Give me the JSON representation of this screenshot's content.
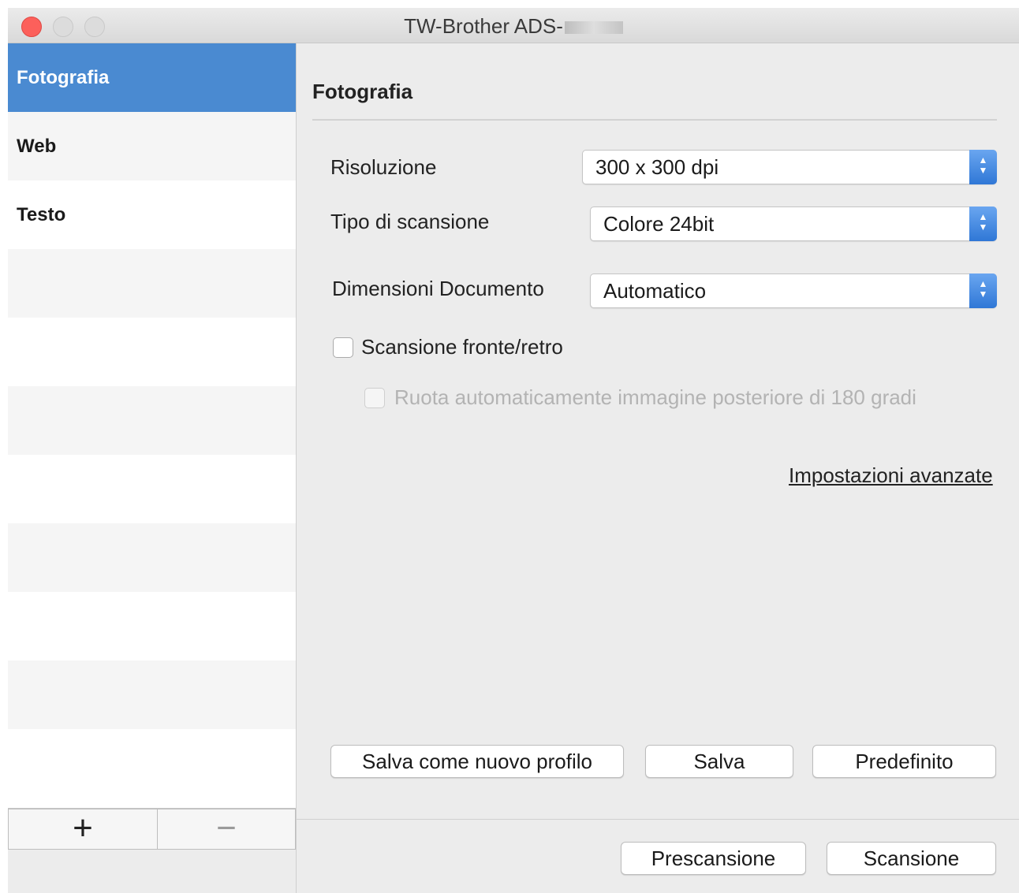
{
  "window": {
    "title": "TW-Brother ADS-"
  },
  "sidebar": {
    "items": [
      {
        "label": "Fotografia",
        "selected": true
      },
      {
        "label": "Web",
        "selected": false
      },
      {
        "label": "Testo",
        "selected": false
      }
    ],
    "add_label": "+",
    "remove_label": "−"
  },
  "main": {
    "section_title": "Fotografia",
    "resolution": {
      "label": "Risoluzione",
      "value": "300 x 300 dpi"
    },
    "scan_type": {
      "label": "Tipo di scansione",
      "value": "Colore 24bit"
    },
    "document_size": {
      "label": "Dimensioni Documento",
      "value": "Automatico"
    },
    "duplex": {
      "label": "Scansione fronte/retro",
      "checked": false
    },
    "auto_rotate": {
      "label": "Ruota automaticamente immagine posteriore di 180 gradi",
      "checked": false,
      "disabled": true
    },
    "advanced_link": "Impostazioni avanzate",
    "buttons": {
      "save_new": "Salva come nuovo profilo",
      "save": "Salva",
      "default": "Predefinito"
    }
  },
  "footer": {
    "prescan": "Prescansione",
    "scan": "Scansione"
  },
  "colors": {
    "selection": "#4a8ad1",
    "close_button": "#fc605b",
    "stepper": "#2f77d6"
  }
}
